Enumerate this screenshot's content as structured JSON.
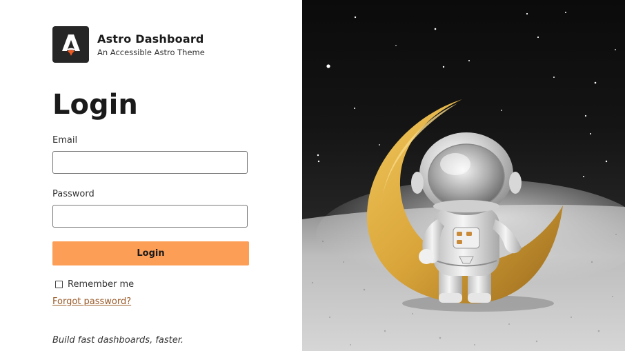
{
  "brand": {
    "title": "Astro Dashboard",
    "subtitle": "An Accessible Astro Theme",
    "logo_icon": "astro-rocket-logo-icon",
    "logo_bg": "#262626",
    "logo_accent": "#f15a22"
  },
  "login": {
    "heading": "Login",
    "email_label": "Email",
    "email_value": "",
    "password_label": "Password",
    "password_value": "",
    "submit_label": "Login",
    "remember_label": "Remember me",
    "remember_checked": false,
    "forgot_label": "Forgot password?"
  },
  "tagline": "Build fast dashboards, faster.",
  "colors": {
    "button_bg": "#fd9e56",
    "link": "#9a5a28",
    "panel_bg": "#ffffff"
  },
  "hero_image": {
    "description_icon": "astronaut-on-moon-image"
  }
}
